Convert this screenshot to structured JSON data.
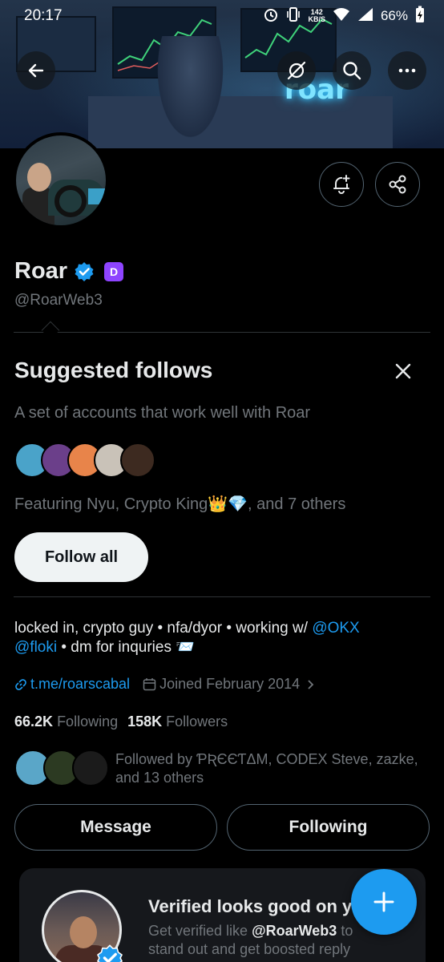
{
  "status_bar": {
    "time": "20:17",
    "net_speed_value": "142",
    "net_speed_unit": "KB/S",
    "battery": "66%"
  },
  "banner": {
    "sign_text": "roar"
  },
  "profile": {
    "name": "Roar",
    "handle": "@RoarWeb3",
    "affiliate_badge": "D",
    "verified": true
  },
  "suggested": {
    "title": "Suggested follows",
    "description": "A set of accounts that work well with Roar",
    "featuring": "Featuring Nyu, Crypto King👑💎, and 7 others",
    "follow_all_label": "Follow all",
    "face_colors": [
      "#4aa3c9",
      "#6b3f8a",
      "#e8844a",
      "#c9c2b8",
      "#3d2a20"
    ]
  },
  "bio": {
    "text_before": "locked in, crypto guy • nfa/dyor • working w/ ",
    "mention1": "@OKX",
    "mention2": "@floki",
    "text_after": " • dm for inquries 📨"
  },
  "meta": {
    "link": "t.me/roarscabal",
    "joined": "Joined February 2014"
  },
  "stats": {
    "following_count": "66.2K",
    "following_label": "Following",
    "followers_count": "158K",
    "followers_label": "Followers"
  },
  "followed_by": {
    "text": "Followed by ƤƦЄЄƬΔM, CODEX Steve, zazke, and 13 others",
    "face_colors": [
      "#5aa6c8",
      "#2c3a22",
      "#1b1b1b"
    ]
  },
  "actions": {
    "message_label": "Message",
    "following_label": "Following"
  },
  "promo": {
    "title": "Verified looks good on yo",
    "text_before": "Get verified like ",
    "handle": "@RoarWeb3",
    "text_after": " to stand out and get boosted reply"
  },
  "colors": {
    "accent": "#1d9bf0",
    "affiliate_badge_bg": "#8e44ff",
    "muted_text": "#71767b"
  }
}
